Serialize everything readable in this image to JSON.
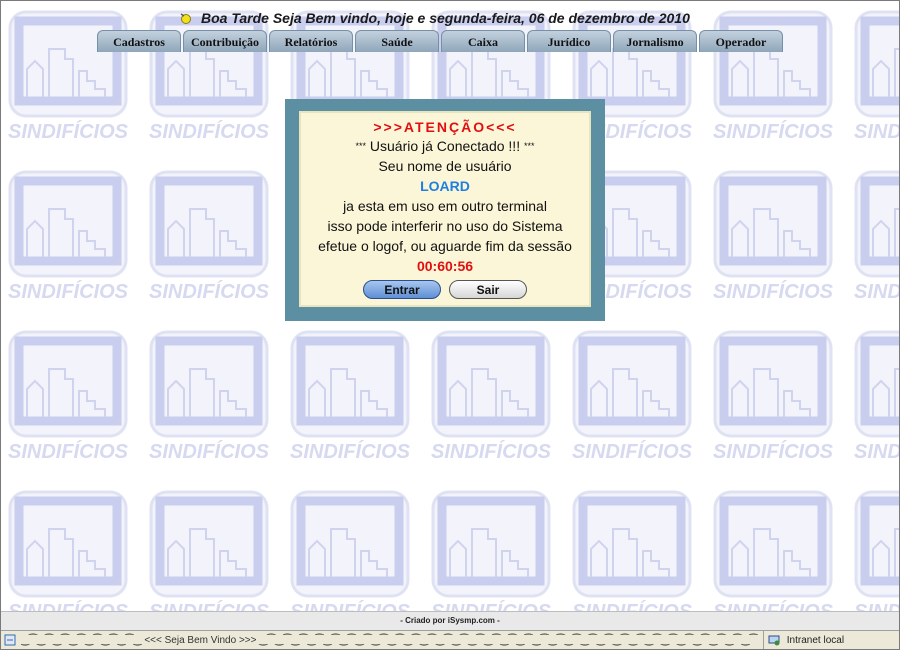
{
  "header": {
    "greeting": "Boa Tarde Seja Bem vindo, hoje e segunda-feira, 06 de dezembro de 2010"
  },
  "nav": {
    "tabs": [
      "Cadastros",
      "Contribuição",
      "Relatórios",
      "Saúde",
      "Caixa",
      "Jurídico",
      "Jornalismo",
      "Operador"
    ]
  },
  "background": {
    "watermark": "SINDIFÍCIOS"
  },
  "dialog": {
    "title": ">>>ATENÇÃO<<<",
    "connected_prefix": "***",
    "connected": "Usuário já Conectado !!!",
    "connected_suffix": "***",
    "line_username_label": "Seu nome de usuário",
    "username": "LOARD",
    "line_in_use": "ja esta em uso em outro terminal",
    "line_interfere": "isso pode interferir no uso do Sistema",
    "line_logoff": "efetue o logof, ou aguarde fim da sessão",
    "timer": "00:60:56",
    "enter_button": "Entrar",
    "exit_button": "Sair"
  },
  "footer": {
    "credit": "-  Criado por iSysmp.com  -"
  },
  "statusbar": {
    "marquee": "‿⁀‿⁀‿⁀‿⁀‿⁀‿⁀‿⁀‿ <<< Seja Bem Vindo >>> ‿⁀‿⁀‿⁀‿⁀‿⁀‿⁀‿⁀‿⁀‿⁀‿⁀‿⁀‿⁀‿⁀‿⁀‿⁀‿⁀‿⁀‿⁀‿⁀‿⁀‿⁀‿⁀‿⁀‿⁀‿⁀‿⁀‿⁀‿⁀‿⁀‿⁀‿⁀",
    "zone": "Intranet local"
  },
  "colors": {
    "dialog_border": "#5d8fa3",
    "dialog_bg": "#fcf6d9",
    "alert_red": "#e01010",
    "username_blue": "#1e7fe0",
    "watermark": "#d6d9f0"
  }
}
